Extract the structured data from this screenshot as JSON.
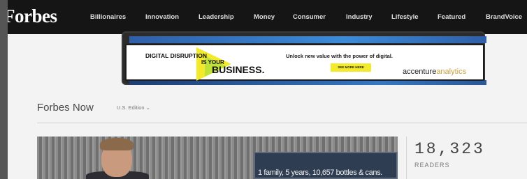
{
  "header": {
    "logo_text": "Forbes",
    "nav": [
      "Billionaires",
      "Innovation",
      "Leadership",
      "Money",
      "Consumer",
      "Industry",
      "Lifestyle",
      "Featured",
      "BrandVoice"
    ]
  },
  "ad": {
    "line1": "DIGITAL DISRUPTION",
    "line2": "IS YOUR",
    "line3": "BUSINESS.",
    "tagline": "Unlock new value with the power of digital.",
    "cta": "SEE MORE HERE",
    "brand_a": "accenture",
    "brand_b": "analytics",
    "accent_color": "#f2ea2a"
  },
  "section": {
    "title": "Forbes Now",
    "edition": "U.S. Edition ⌄"
  },
  "feature": {
    "sign_text": "1 family, 5 years, 10,657 bottles & cans."
  },
  "stats": {
    "readers_count": "18,323",
    "readers_label": "READERS"
  }
}
